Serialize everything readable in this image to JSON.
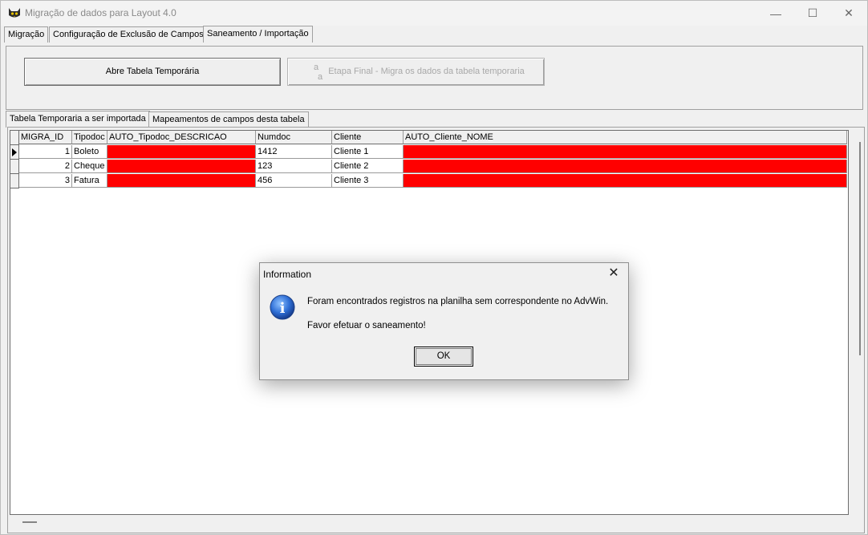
{
  "window": {
    "title": "Migração de dados para Layout 4.0",
    "minimize_glyph": "—",
    "maximize_glyph": "☐",
    "close_glyph": "✕"
  },
  "top_tabs": [
    "Migração",
    "Configuração de Exclusão de Campos",
    "Saneamento / Importação"
  ],
  "active_top_tab": "Saneamento / Importação",
  "buttons": {
    "open_temp_table": "Abre Tabela Temporária",
    "final_step": "Etapa Final -  Migra os dados da tabela temporaria",
    "final_step_icon_top": "a",
    "final_step_icon_bottom": "a"
  },
  "inner_tabs": [
    "Tabela Temporaria a ser importada",
    "Mapeamentos de campos desta tabela"
  ],
  "active_inner_tab": "Tabela Temporaria a ser importada",
  "grid": {
    "columns": [
      "MIGRA_ID",
      "Tipodoc",
      "AUTO_Tipodoc_DESCRICAO",
      "Numdoc",
      "Cliente",
      "AUTO_Cliente_NOME"
    ],
    "rows": [
      {
        "migra_id": "1",
        "tipodoc": "Boleto",
        "auto_tipodoc_descricao": "",
        "numdoc": "1412",
        "cliente": "Cliente 1",
        "auto_cliente_nome": ""
      },
      {
        "migra_id": "2",
        "tipodoc": "Cheque",
        "auto_tipodoc_descricao": "",
        "numdoc": "123",
        "cliente": "Cliente 2",
        "auto_cliente_nome": ""
      },
      {
        "migra_id": "3",
        "tipodoc": "Fatura",
        "auto_tipodoc_descricao": "",
        "numdoc": "456",
        "cliente": "Cliente 3",
        "auto_cliente_nome": ""
      }
    ],
    "highlight_color": "#ff0000"
  },
  "dialog": {
    "title": "Information",
    "close_glyph": "✕",
    "message_line1": "Foram encontrados registros na planilha sem correspondente no AdvWin.",
    "message_line2": "Favor efetuar o saneamento!",
    "ok_label": "OK",
    "icon": "info-icon",
    "icon_glyph": "i"
  }
}
